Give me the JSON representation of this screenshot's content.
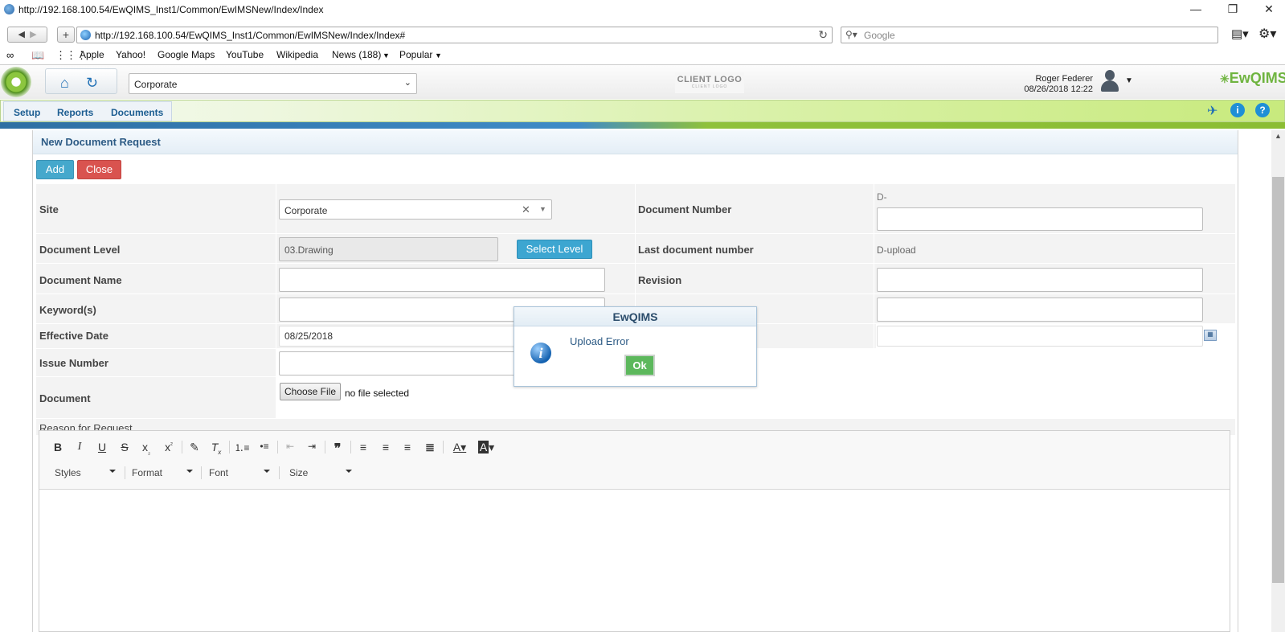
{
  "window": {
    "title": "http://192.168.100.54/EwQIMS_Inst1/Common/EwIMSNew/Index/Index",
    "min": "—",
    "restore": "❐",
    "close": "✕"
  },
  "browser": {
    "url": "http://192.168.100.54/EwQIMS_Inst1/Common/EwIMSNew/Index/Index#",
    "search_placeholder": "Google",
    "bookmarks": [
      "Apple",
      "Yahoo!",
      "Google Maps",
      "YouTube",
      "Wikipedia",
      "News (188)",
      "Popular"
    ]
  },
  "app": {
    "site_selected": "Corporate",
    "client_logo": "CLIENT LOGO",
    "client_logo_sub": "CLIENT LOGO",
    "user_name": "Roger Federer",
    "user_datetime": "08/26/2018 12:22",
    "brand": "EwQIMS",
    "menu": [
      "Setup",
      "Reports",
      "Documents"
    ]
  },
  "panel": {
    "title": "New Document Request",
    "add_label": "Add",
    "close_label": "Close"
  },
  "form": {
    "site_label": "Site",
    "site_value": "Corporate",
    "doc_number_label": "Document Number",
    "doc_number_prefix": "D-",
    "doc_level_label": "Document Level",
    "doc_level_value": "03.Drawing",
    "select_level_label": "Select Level",
    "last_doc_label": "Last document number",
    "last_doc_value": "D-upload",
    "doc_name_label": "Document Name",
    "revision_label": "Revision",
    "keywords_label": "Keyword(s)",
    "effective_date_label": "Effective Date",
    "effective_date_value": "08/25/2018",
    "issue_number_label": "Issue Number",
    "document_label": "Document",
    "choose_file_label": "Choose File",
    "no_file_label": "no file selected",
    "reason_label": "Reason for Request"
  },
  "editor": {
    "styles": "Styles",
    "format": "Format",
    "font": "Font",
    "size": "Size"
  },
  "dialog": {
    "title": "EwQIMS",
    "message": "Upload Error",
    "ok_label": "Ok"
  },
  "colors": {
    "add": "#45a8cc",
    "close": "#d9534f",
    "ok": "#5cb85c",
    "select_level": "#3da6d1"
  }
}
